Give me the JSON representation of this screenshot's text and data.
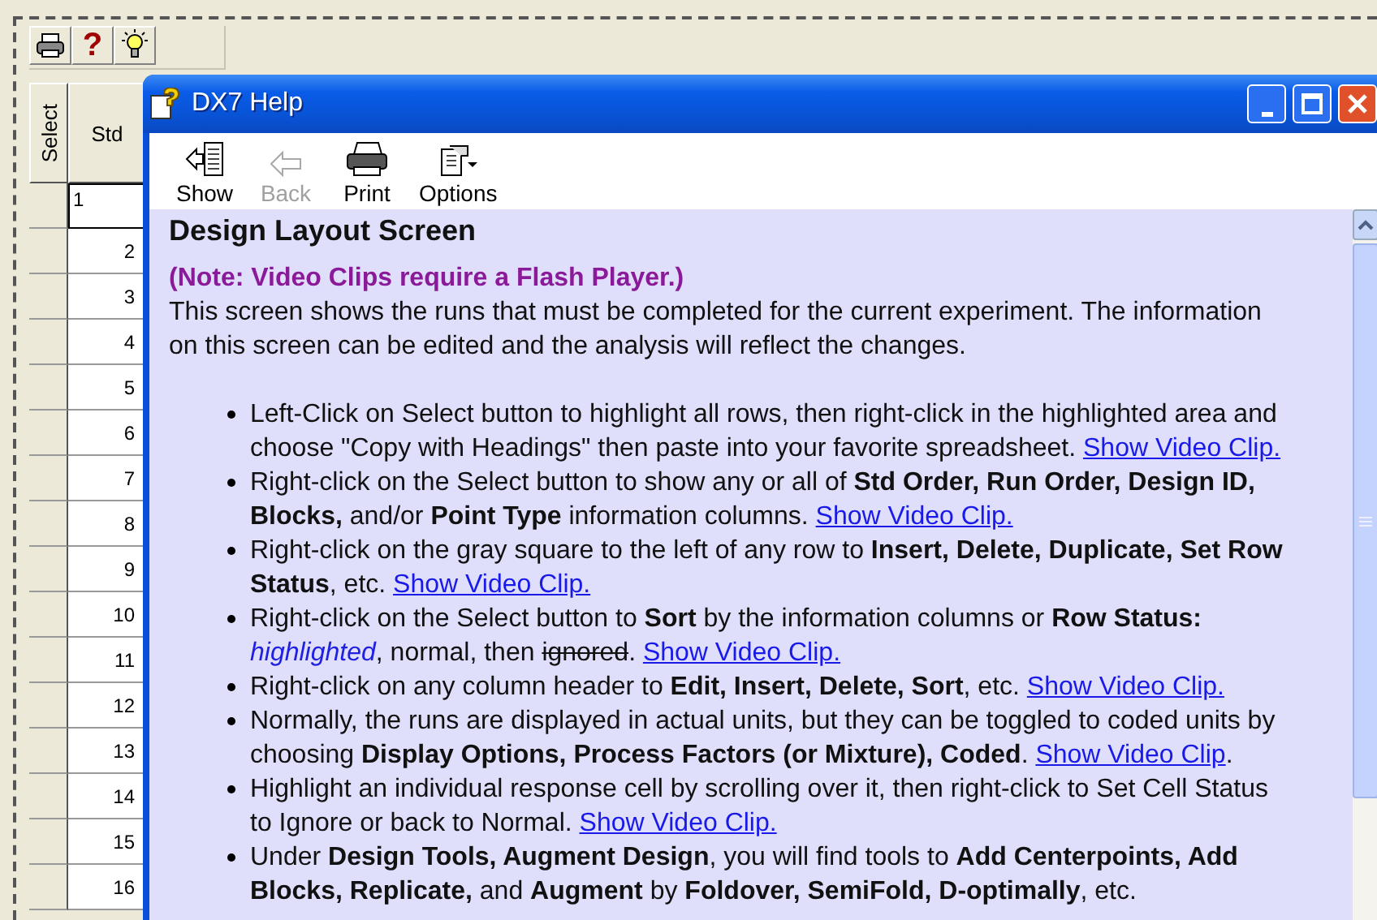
{
  "app_toolbar": [
    {
      "kind": "print"
    },
    {
      "kind": "help",
      "glyph": "?"
    },
    {
      "kind": "tip"
    }
  ],
  "grid": {
    "columns": [
      "Select",
      "Std"
    ],
    "rows": [
      {
        "std": "1",
        "editing": true
      },
      {
        "std": "2",
        "editing": false
      },
      {
        "std": "3",
        "editing": false
      },
      {
        "std": "4",
        "editing": false
      },
      {
        "std": "5",
        "editing": false
      },
      {
        "std": "6",
        "editing": false
      },
      {
        "std": "7",
        "editing": false
      },
      {
        "std": "8",
        "editing": false
      },
      {
        "std": "9",
        "editing": false
      },
      {
        "std": "10",
        "editing": false
      },
      {
        "std": "11",
        "editing": false
      },
      {
        "std": "12",
        "editing": false
      },
      {
        "std": "13",
        "editing": false
      },
      {
        "std": "14",
        "editing": false
      },
      {
        "std": "15",
        "editing": false
      },
      {
        "std": "16",
        "editing": false
      }
    ]
  },
  "help_window": {
    "title": "DX7 Help",
    "toolbar": [
      {
        "kind": "show",
        "label": "Show",
        "disabled": false
      },
      {
        "kind": "back",
        "label": "Back",
        "disabled": true
      },
      {
        "kind": "print",
        "label": "Print",
        "disabled": false
      },
      {
        "kind": "options",
        "label": "Options",
        "disabled": false
      }
    ],
    "heading": "Design Layout Screen",
    "note": "(Note: Video Clips require a Flash Player.)",
    "intro": "This screen shows the runs that must be completed for the current experiment.  The information on this screen can be edited and the analysis will reflect the changes.",
    "bullets": [
      [
        {
          "kind": "text",
          "text": "Left-Click on Select button to highlight all rows, then right-click in the highlighted area and choose \"Copy with Headings\" then paste into your favorite spreadsheet. "
        },
        {
          "kind": "link",
          "text": "Show Video Clip."
        }
      ],
      [
        {
          "kind": "text",
          "text": "Right-click on the Select button to show any or all of **Std Order, Run Order, Design ID, Blocks,** and/or **Point Type** information columns.  "
        },
        {
          "kind": "link",
          "text": "Show Video Clip."
        }
      ],
      [
        {
          "kind": "text",
          "text": "Right-click on the gray square to the left of any row to **Insert, Delete, Duplicate, Set Row Status**, etc. "
        },
        {
          "kind": "link",
          "text": "Show Video Clip."
        }
      ],
      [
        {
          "kind": "text",
          "text": "Right-click on the Select button to **Sort** by the information columns or **Row Status:** *highlighted*, normal, then "
        },
        {
          "kind": "struck",
          "text": "ignored"
        },
        {
          "kind": "text",
          "text": ".  "
        },
        {
          "kind": "link",
          "text": "Show Video Clip."
        }
      ],
      [
        {
          "kind": "text",
          "text": "Right-click on any column header to **Edit, Insert, Delete, Sort**, etc. "
        },
        {
          "kind": "link",
          "text": "Show Video Clip."
        }
      ],
      [
        {
          "kind": "text",
          "text": "Normally, the runs are displayed in actual units, but they can be toggled to coded units by choosing **Display Options, Process Factors (or Mixture), Coded**. "
        },
        {
          "kind": "link",
          "text": "Show Video Clip"
        },
        {
          "kind": "text",
          "text": "."
        }
      ],
      [
        {
          "kind": "text",
          "text": "Highlight an individual response cell by scrolling over it, then right-click to Set Cell Status to Ignore or back to Normal. "
        },
        {
          "kind": "link",
          "text": "Show Video Clip."
        }
      ],
      [
        {
          "kind": "text",
          "text": "Under **Design Tools, Augment Design**, you will find tools to **Add Centerpoints, Add Blocks, Replicate,** and **Augment** by **Foldover, SemiFold, D-optimally**, etc."
        }
      ]
    ]
  }
}
